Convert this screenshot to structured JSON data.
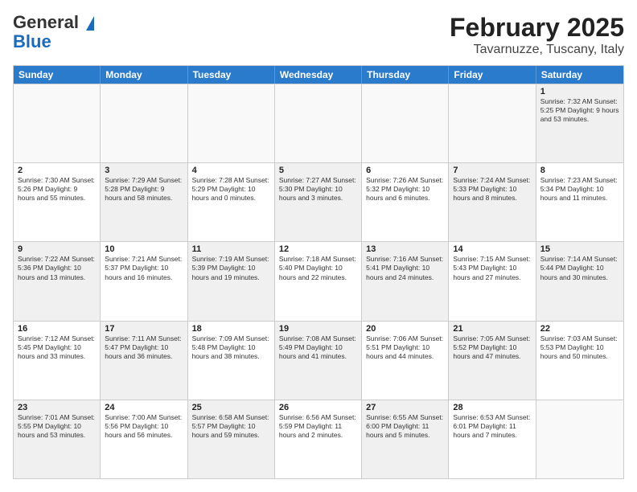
{
  "logo": {
    "line1": "General",
    "line2": "Blue",
    "triangle": true
  },
  "title": "February 2025",
  "location": "Tavarnuzze, Tuscany, Italy",
  "weekdays": [
    "Sunday",
    "Monday",
    "Tuesday",
    "Wednesday",
    "Thursday",
    "Friday",
    "Saturday"
  ],
  "rows": [
    [
      {
        "day": "",
        "info": "",
        "empty": true
      },
      {
        "day": "",
        "info": "",
        "empty": true
      },
      {
        "day": "",
        "info": "",
        "empty": true
      },
      {
        "day": "",
        "info": "",
        "empty": true
      },
      {
        "day": "",
        "info": "",
        "empty": true
      },
      {
        "day": "",
        "info": "",
        "empty": true
      },
      {
        "day": "1",
        "info": "Sunrise: 7:32 AM\nSunset: 5:25 PM\nDaylight: 9 hours and 53 minutes.",
        "shaded": true
      }
    ],
    [
      {
        "day": "2",
        "info": "Sunrise: 7:30 AM\nSunset: 5:26 PM\nDaylight: 9 hours and 55 minutes."
      },
      {
        "day": "3",
        "info": "Sunrise: 7:29 AM\nSunset: 5:28 PM\nDaylight: 9 hours and 58 minutes.",
        "shaded": true
      },
      {
        "day": "4",
        "info": "Sunrise: 7:28 AM\nSunset: 5:29 PM\nDaylight: 10 hours and 0 minutes."
      },
      {
        "day": "5",
        "info": "Sunrise: 7:27 AM\nSunset: 5:30 PM\nDaylight: 10 hours and 3 minutes.",
        "shaded": true
      },
      {
        "day": "6",
        "info": "Sunrise: 7:26 AM\nSunset: 5:32 PM\nDaylight: 10 hours and 6 minutes."
      },
      {
        "day": "7",
        "info": "Sunrise: 7:24 AM\nSunset: 5:33 PM\nDaylight: 10 hours and 8 minutes.",
        "shaded": true
      },
      {
        "day": "8",
        "info": "Sunrise: 7:23 AM\nSunset: 5:34 PM\nDaylight: 10 hours and 11 minutes."
      }
    ],
    [
      {
        "day": "9",
        "info": "Sunrise: 7:22 AM\nSunset: 5:36 PM\nDaylight: 10 hours and 13 minutes.",
        "shaded": true
      },
      {
        "day": "10",
        "info": "Sunrise: 7:21 AM\nSunset: 5:37 PM\nDaylight: 10 hours and 16 minutes."
      },
      {
        "day": "11",
        "info": "Sunrise: 7:19 AM\nSunset: 5:39 PM\nDaylight: 10 hours and 19 minutes.",
        "shaded": true
      },
      {
        "day": "12",
        "info": "Sunrise: 7:18 AM\nSunset: 5:40 PM\nDaylight: 10 hours and 22 minutes."
      },
      {
        "day": "13",
        "info": "Sunrise: 7:16 AM\nSunset: 5:41 PM\nDaylight: 10 hours and 24 minutes.",
        "shaded": true
      },
      {
        "day": "14",
        "info": "Sunrise: 7:15 AM\nSunset: 5:43 PM\nDaylight: 10 hours and 27 minutes."
      },
      {
        "day": "15",
        "info": "Sunrise: 7:14 AM\nSunset: 5:44 PM\nDaylight: 10 hours and 30 minutes.",
        "shaded": true
      }
    ],
    [
      {
        "day": "16",
        "info": "Sunrise: 7:12 AM\nSunset: 5:45 PM\nDaylight: 10 hours and 33 minutes."
      },
      {
        "day": "17",
        "info": "Sunrise: 7:11 AM\nSunset: 5:47 PM\nDaylight: 10 hours and 36 minutes.",
        "shaded": true
      },
      {
        "day": "18",
        "info": "Sunrise: 7:09 AM\nSunset: 5:48 PM\nDaylight: 10 hours and 38 minutes."
      },
      {
        "day": "19",
        "info": "Sunrise: 7:08 AM\nSunset: 5:49 PM\nDaylight: 10 hours and 41 minutes.",
        "shaded": true
      },
      {
        "day": "20",
        "info": "Sunrise: 7:06 AM\nSunset: 5:51 PM\nDaylight: 10 hours and 44 minutes."
      },
      {
        "day": "21",
        "info": "Sunrise: 7:05 AM\nSunset: 5:52 PM\nDaylight: 10 hours and 47 minutes.",
        "shaded": true
      },
      {
        "day": "22",
        "info": "Sunrise: 7:03 AM\nSunset: 5:53 PM\nDaylight: 10 hours and 50 minutes."
      }
    ],
    [
      {
        "day": "23",
        "info": "Sunrise: 7:01 AM\nSunset: 5:55 PM\nDaylight: 10 hours and 53 minutes.",
        "shaded": true
      },
      {
        "day": "24",
        "info": "Sunrise: 7:00 AM\nSunset: 5:56 PM\nDaylight: 10 hours and 56 minutes."
      },
      {
        "day": "25",
        "info": "Sunrise: 6:58 AM\nSunset: 5:57 PM\nDaylight: 10 hours and 59 minutes.",
        "shaded": true
      },
      {
        "day": "26",
        "info": "Sunrise: 6:56 AM\nSunset: 5:59 PM\nDaylight: 11 hours and 2 minutes."
      },
      {
        "day": "27",
        "info": "Sunrise: 6:55 AM\nSunset: 6:00 PM\nDaylight: 11 hours and 5 minutes.",
        "shaded": true
      },
      {
        "day": "28",
        "info": "Sunrise: 6:53 AM\nSunset: 6:01 PM\nDaylight: 11 hours and 7 minutes."
      },
      {
        "day": "",
        "info": "",
        "empty": true
      }
    ]
  ]
}
